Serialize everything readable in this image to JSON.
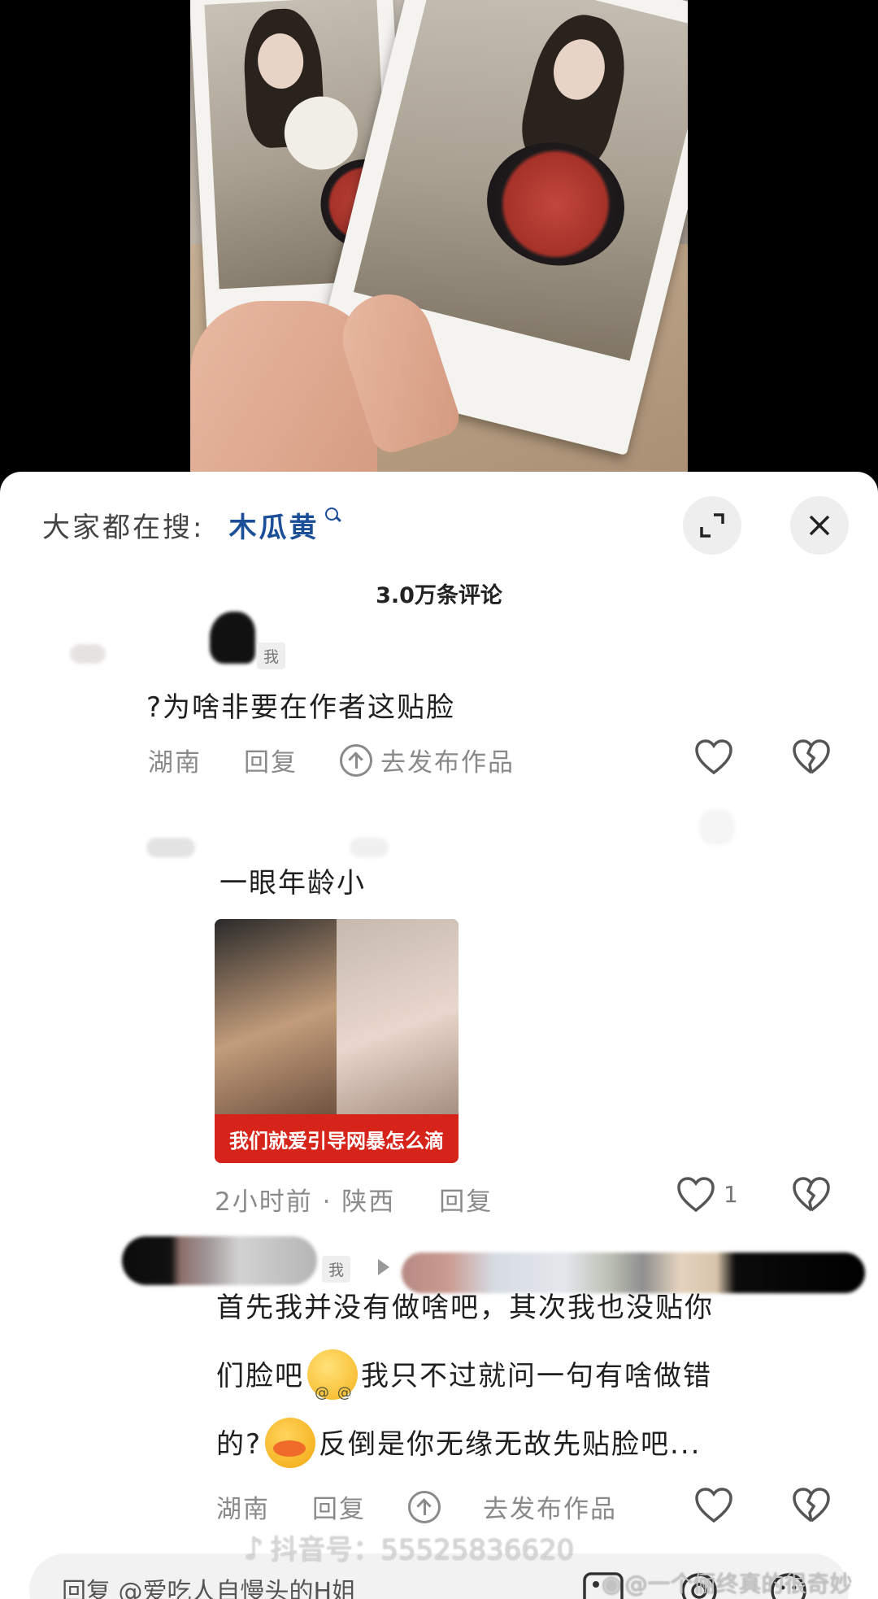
{
  "search": {
    "prefix": "大家都在搜:",
    "term": "木瓜黄"
  },
  "comments_header": {
    "count": "3.0万条评论"
  },
  "comments": [
    {
      "author_tag": "我",
      "text": "?为啥非要在作者这贴脸",
      "location": "湖南",
      "reply_label": "回复",
      "post_works_label": "去发布作品"
    },
    {
      "text": "一眼年龄小",
      "image_caption": "我们就爱引导网暴怎么滴",
      "time_location": "2小时前 · 陕西",
      "reply_label": "回复",
      "like_count": "1"
    },
    {
      "author_tag": "我",
      "text_line1": "首先我并没有做啥吧，其次我也没贴你",
      "text_line2a": "们脸吧",
      "text_line2b": "我只不过就问一句有啥做错",
      "text_line3a": "的?",
      "text_line3b": "反倒是你无缘无故先贴脸吧...",
      "location": "湖南",
      "reply_label": "回复",
      "post_works_label": "去发布作品"
    }
  ],
  "reply_input": {
    "placeholder": "回复 @爱吃人自慢头的H姐"
  },
  "watermarks": {
    "douyin": "抖音号：55525836620",
    "weibo": "@一个俪终真的很奇妙"
  },
  "icons": [
    "search-icon",
    "expand-icon",
    "close-icon",
    "upload-icon",
    "heart-icon",
    "broken-heart-icon",
    "image-icon",
    "at-icon",
    "emoji-icon"
  ],
  "colors": {
    "search_term": "#1b4f98",
    "caption_bg": "#d6241b",
    "sheet_bg": "#ffffff"
  }
}
